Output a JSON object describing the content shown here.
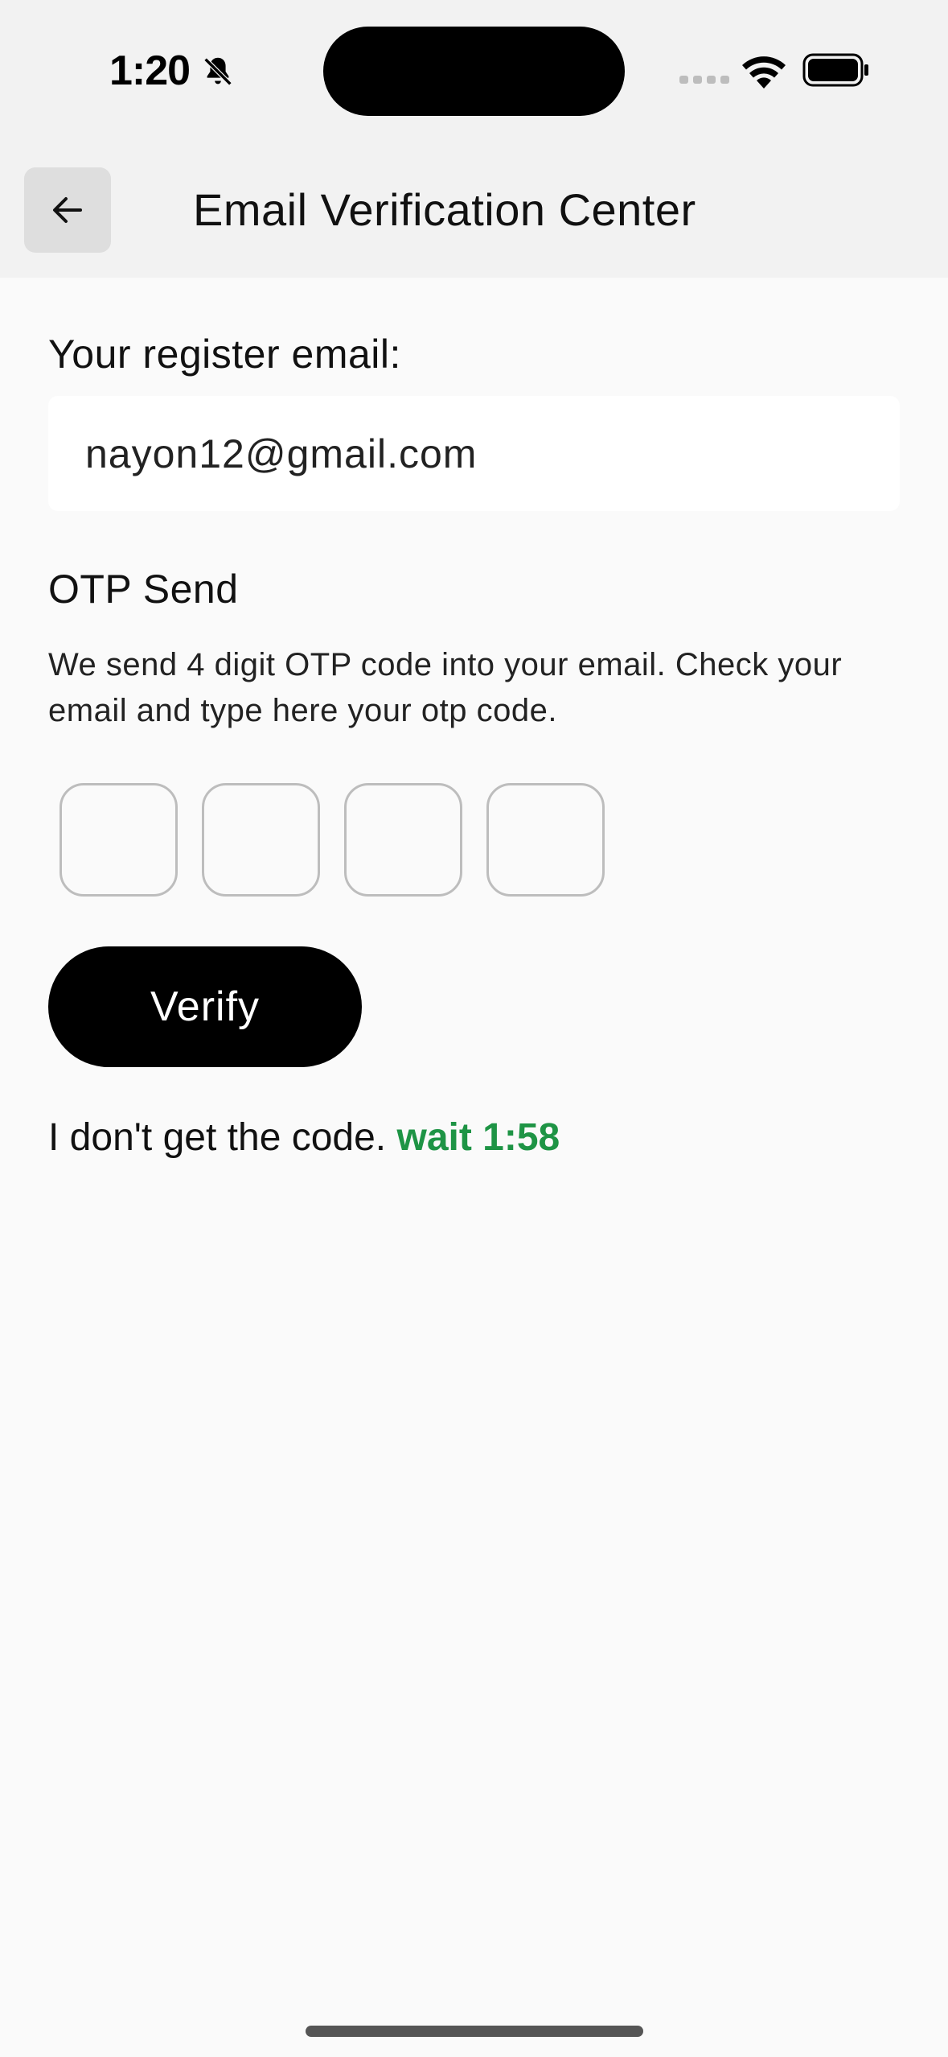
{
  "status_bar": {
    "time": "1:20",
    "icons": [
      "bell-muted-icon",
      "cellular-signal-icon",
      "wifi-icon",
      "battery-icon"
    ]
  },
  "app_bar": {
    "back_icon": "arrow-left-icon",
    "title": "Email Verification Center"
  },
  "email_section": {
    "label": "Your register email:",
    "value": "nayon12@gmail.com"
  },
  "otp_section": {
    "heading": "OTP Send",
    "description": "We send 4 digit OTP code into your email. Check your email and type here your otp code.",
    "digits": [
      "",
      "",
      "",
      ""
    ]
  },
  "verify_button": {
    "label": "Verify"
  },
  "resend": {
    "text": "I don't get the code.",
    "timer": "wait 1:58"
  },
  "colors": {
    "accent_green": "#1e9445",
    "button_black": "#000000",
    "background": "#fafafa",
    "header_background": "#f2f2f2"
  }
}
